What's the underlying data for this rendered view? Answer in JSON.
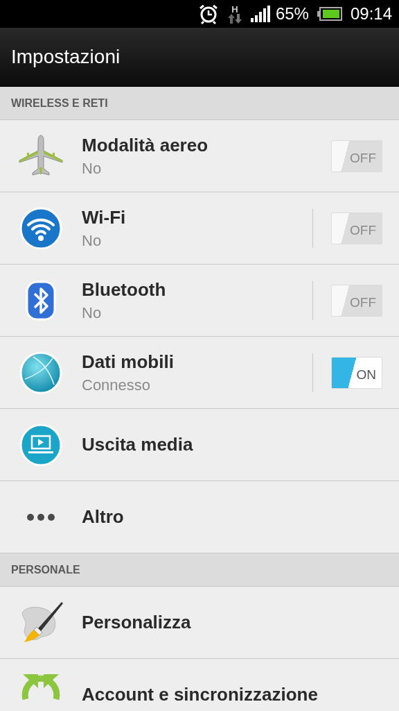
{
  "status_bar": {
    "battery_percent": "65%",
    "time": "09:14",
    "network_type": "H"
  },
  "title_bar": {
    "title": "Impostazioni"
  },
  "sections": [
    {
      "header": "WIRELESS E RETI",
      "items": [
        {
          "title": "Modalità aereo",
          "subtitle": "No",
          "split": false,
          "toggle": {
            "on": false,
            "label": "OFF"
          }
        },
        {
          "title": "Wi-Fi",
          "subtitle": "No",
          "split": true,
          "toggle": {
            "on": false,
            "label": "OFF"
          }
        },
        {
          "title": "Bluetooth",
          "subtitle": "No",
          "split": true,
          "toggle": {
            "on": false,
            "label": "OFF"
          }
        },
        {
          "title": "Dati mobili",
          "subtitle": "Connesso",
          "split": true,
          "toggle": {
            "on": true,
            "label": "ON"
          }
        },
        {
          "title": "Uscita media"
        },
        {
          "title": "Altro"
        }
      ]
    },
    {
      "header": "PERSONALE",
      "items": [
        {
          "title": "Personalizza"
        },
        {
          "title": "Account e sincronizzazione"
        }
      ]
    }
  ]
}
